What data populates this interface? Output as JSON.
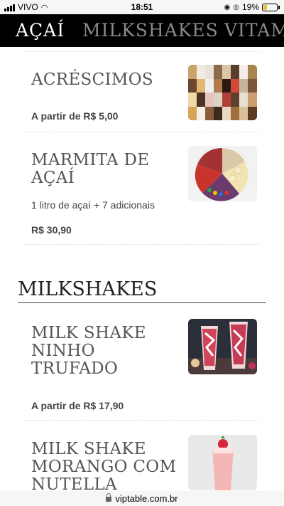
{
  "status_bar": {
    "carrier": "VIVO",
    "time": "18:51",
    "battery_percent": "19%"
  },
  "tabs": [
    {
      "label": "AÇAÍ",
      "active": true
    },
    {
      "label": "MILKSHAKES",
      "active": false
    },
    {
      "label": "VITAM",
      "active": false
    }
  ],
  "items": [
    {
      "title_lines": [
        "ACRÉSCIMOS"
      ],
      "description": "",
      "price": "A partir de R$ 5,00",
      "image": "toppings-grid"
    },
    {
      "title_lines": [
        "MARMITA DE",
        "AÇAÍ"
      ],
      "description": "1 litro de açaí + 7 adicionais",
      "price": "R$ 30,90",
      "image": "acai-bowl"
    }
  ],
  "section": {
    "title": "MILKSHAKES"
  },
  "milkshakes": [
    {
      "title_lines": [
        "MILK SHAKE",
        "NINHO",
        "TRUFADO"
      ],
      "price": "A partir de R$ 17,90",
      "image": "strawberry-milkshake-glasses"
    },
    {
      "title_lines": [
        "MILK SHAKE",
        "MORANGO COM",
        "NUTELLA"
      ],
      "price": "",
      "image": "pink-milkshake-strawberry"
    }
  ],
  "url_bar": {
    "url": "viptable.com.br"
  }
}
